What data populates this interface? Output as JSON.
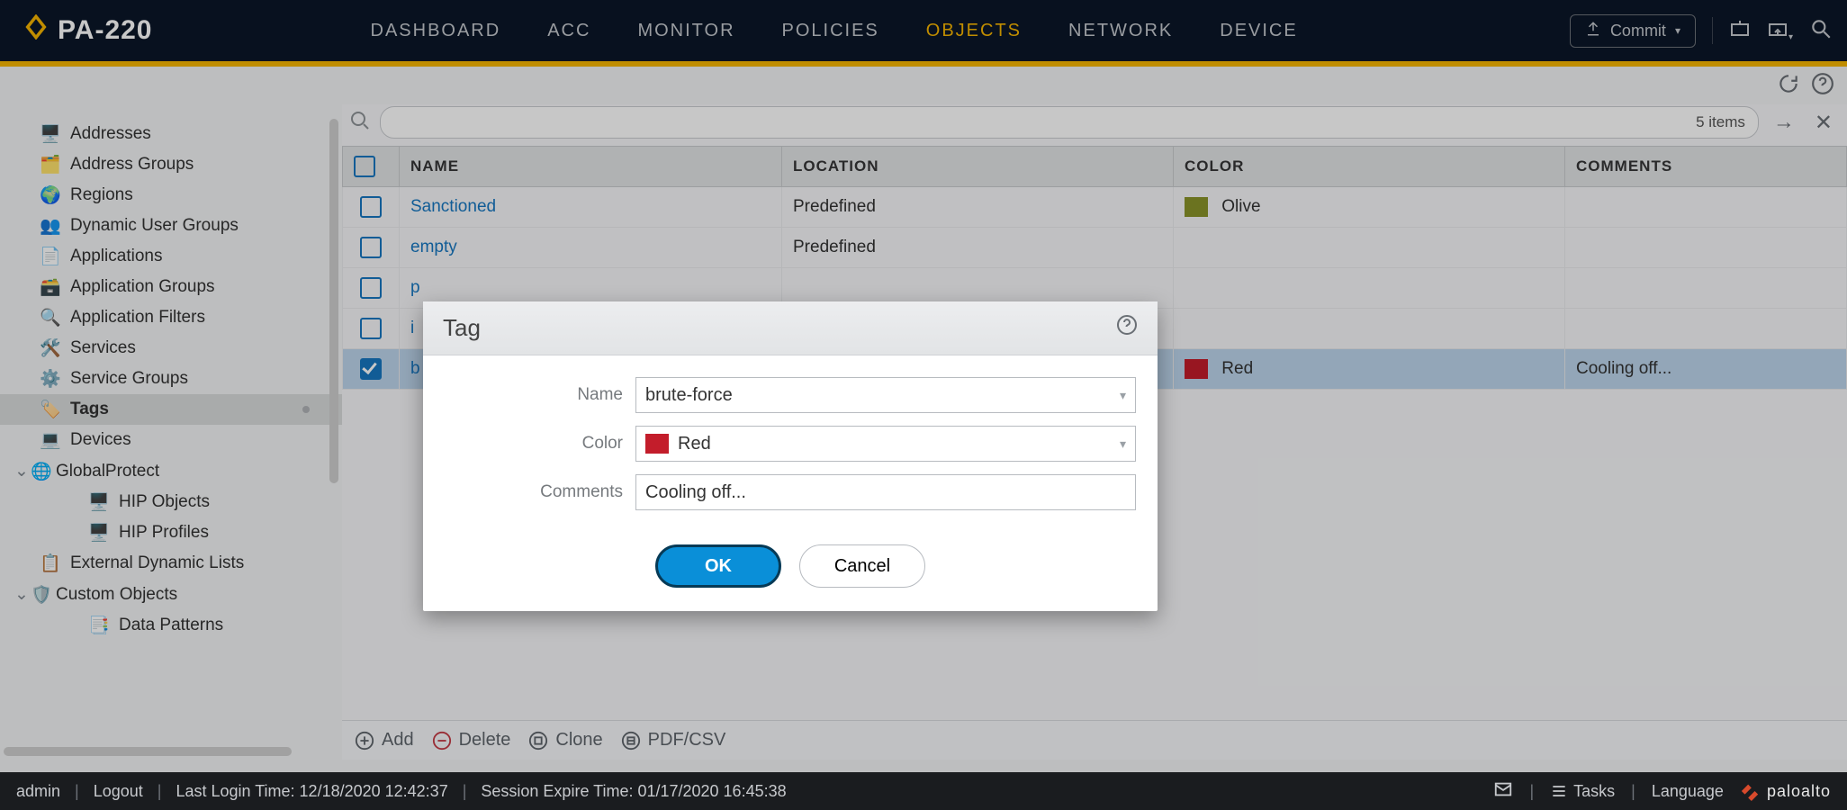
{
  "brand": "PA-220",
  "menu": {
    "dashboard": "DASHBOARD",
    "acc": "ACC",
    "monitor": "MONITOR",
    "policies": "POLICIES",
    "objects": "OBJECTS",
    "network": "NETWORK",
    "device": "DEVICE"
  },
  "commit_label": "Commit",
  "sidebar": {
    "addresses": "Addresses",
    "address_groups": "Address Groups",
    "regions": "Regions",
    "dynamic_user_groups": "Dynamic User Groups",
    "applications": "Applications",
    "application_groups": "Application Groups",
    "application_filters": "Application Filters",
    "services": "Services",
    "service_groups": "Service Groups",
    "tags": "Tags",
    "devices": "Devices",
    "globalprotect": "GlobalProtect",
    "hip_objects": "HIP Objects",
    "hip_profiles": "HIP Profiles",
    "external_dynamic_lists": "External Dynamic Lists",
    "custom_objects": "Custom Objects",
    "data_patterns": "Data Patterns"
  },
  "search": {
    "count": "5 items"
  },
  "columns": {
    "name": "NAME",
    "location": "LOCATION",
    "color": "COLOR",
    "comments": "COMMENTS"
  },
  "rows": [
    {
      "checked": false,
      "name": "Sanctioned",
      "location": "Predefined",
      "color_name": "Olive",
      "color_class": "sw-olive",
      "comments": ""
    },
    {
      "checked": false,
      "name": "empty",
      "location": "Predefined",
      "color_name": "",
      "color_class": "",
      "comments": ""
    },
    {
      "checked": false,
      "name": "p",
      "location": "",
      "color_name": "",
      "color_class": "",
      "comments": ""
    },
    {
      "checked": false,
      "name": "i",
      "location": "",
      "color_name": "",
      "color_class": "",
      "comments": ""
    },
    {
      "checked": true,
      "name": "b",
      "location": "",
      "color_name": "Red",
      "color_class": "sw-red",
      "comments": "Cooling off..."
    }
  ],
  "actions": {
    "add": "Add",
    "delete": "Delete",
    "clone": "Clone",
    "pdfcsv": "PDF/CSV"
  },
  "modal": {
    "title": "Tag",
    "name_label": "Name",
    "name_value": "brute-force",
    "color_label": "Color",
    "color_value": "Red",
    "comments_label": "Comments",
    "comments_value": "Cooling off...",
    "ok": "OK",
    "cancel": "Cancel"
  },
  "footer": {
    "user": "admin",
    "logout": "Logout",
    "last_login": "Last Login Time: 12/18/2020 12:42:37",
    "session": "Session Expire Time: 01/17/2020 16:45:38",
    "tasks": "Tasks",
    "language": "Language",
    "vendor": "paloalto"
  }
}
